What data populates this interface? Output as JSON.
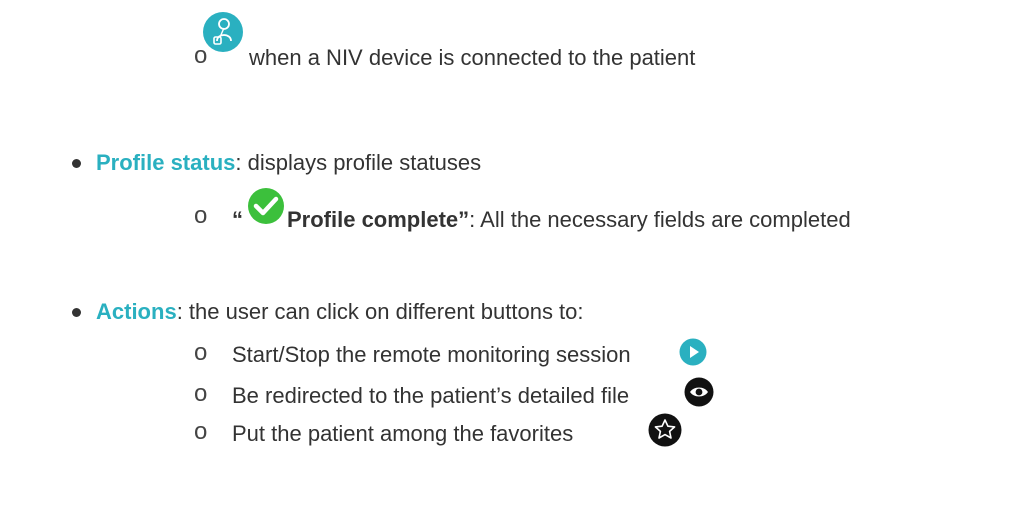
{
  "colors": {
    "accent": "#2ab0c0",
    "text": "#333333",
    "check": "#3cc03c",
    "icon_dark": "#111111"
  },
  "sub_marker": "o",
  "niv": {
    "icon": "niv-device-icon",
    "text": "when a NIV device is connected to the patient"
  },
  "profile_status": {
    "label": "Profile status",
    "desc": ": displays profile statuses",
    "item": {
      "open_quote": "“",
      "icon": "check-circle-icon",
      "title": "Profile complete”",
      "desc": ": All the necessary fields are completed"
    }
  },
  "actions": {
    "label": "Actions",
    "desc": ": the user can click on different buttons to:",
    "items": [
      {
        "text": "Start/Stop the remote monitoring session",
        "icon": "play-icon"
      },
      {
        "text": " Be redirected to the patient’s detailed file",
        "icon": "eye-icon"
      },
      {
        "text": "Put the patient among the favorites",
        "icon": "star-icon"
      }
    ]
  }
}
